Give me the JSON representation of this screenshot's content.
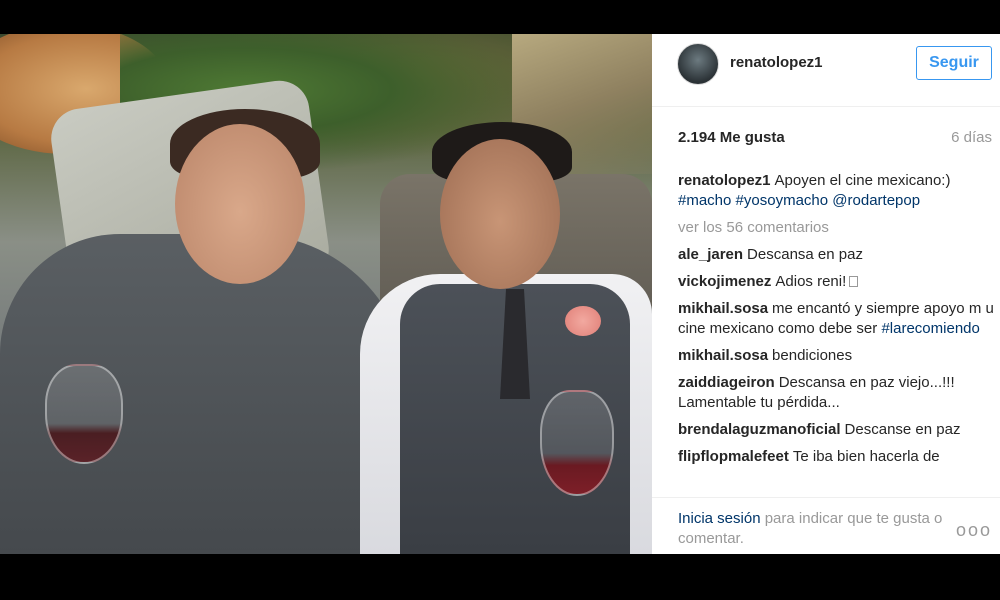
{
  "post": {
    "username": "renatolopez1",
    "follow_label": "Seguir",
    "likes": "2.194 Me gusta",
    "time_ago": "6 días",
    "caption": {
      "user": "renatolopez1",
      "text": "Apoyen el cine mexicano:)",
      "tags": [
        "#macho",
        "#yosoymacho",
        "@rodartepop"
      ]
    },
    "view_comments": "ver los 56 comentarios",
    "comments": [
      {
        "user": "ale_jaren",
        "text": "Descansa en paz"
      },
      {
        "user": "vickojimenez",
        "text": "Adios reni!"
      },
      {
        "user": "mikhail.sosa",
        "text": "me encantó y siempre apoyo m u cine mexicano como debe ser",
        "tag": "#larecomiendo"
      },
      {
        "user": "mikhail.sosa",
        "text": "bendiciones"
      },
      {
        "user": "zaiddiageiron",
        "text": "Descansa en paz viejo...!!! Lamentable tu pérdida..."
      },
      {
        "user": "brendalaguzmanoficial",
        "text": "Descanse en paz"
      },
      {
        "user": "flipflopmalefeet",
        "text": "Te iba bien hacerla de"
      }
    ],
    "footer": {
      "login_link": "Inicia sesión",
      "login_text": "para indicar que te gusta o comentar.",
      "more_icon": "ellipsis-icon",
      "more_glyph": "ooo"
    }
  },
  "colors": {
    "link_blue": "#003569",
    "follow_blue": "#3897f0",
    "muted_gray": "#999999",
    "text_dark": "#262626"
  }
}
